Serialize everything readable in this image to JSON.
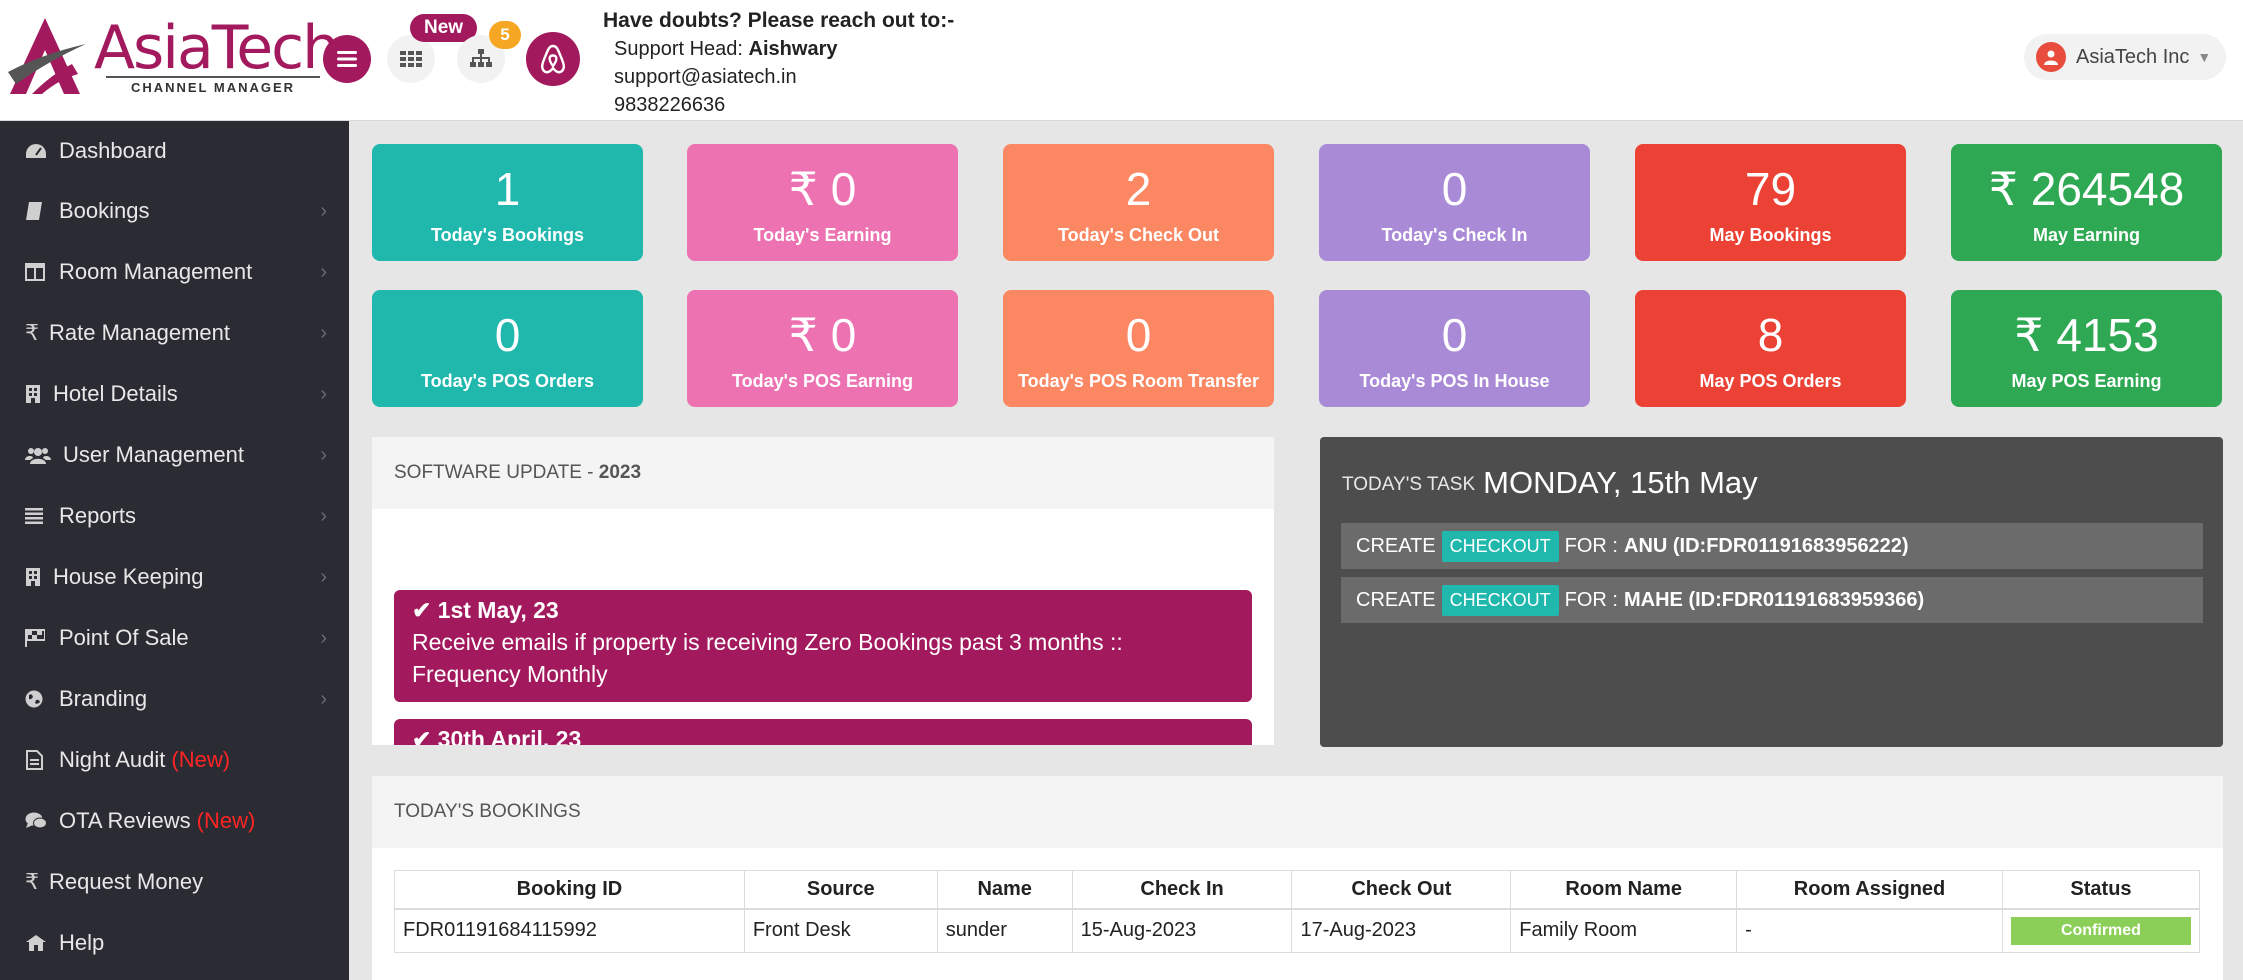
{
  "brand": {
    "name": "AsiaTech",
    "tagline": "CHANNEL MANAGER"
  },
  "header": {
    "new_badge": "New",
    "notification_count": "5",
    "support": {
      "title": "Have doubts? Please reach out to:-",
      "head_label": "Support Head:",
      "head_name": "Aishwary",
      "email": "support@asiatech.in",
      "phone": "9838226636"
    },
    "user": {
      "name": "AsiaTech Inc"
    }
  },
  "sidebar": {
    "items": [
      {
        "label": "Dashboard",
        "icon": "dashboard-icon"
      },
      {
        "label": "Bookings",
        "icon": "book-icon"
      },
      {
        "label": "Room Management",
        "icon": "columns-icon"
      },
      {
        "label": "Rate Management",
        "icon": "rupee-icon"
      },
      {
        "label": "Hotel Details",
        "icon": "building-icon"
      },
      {
        "label": "User Management",
        "icon": "users-icon"
      },
      {
        "label": "Reports",
        "icon": "list-icon"
      },
      {
        "label": "House Keeping",
        "icon": "building-icon"
      },
      {
        "label": "Point Of Sale",
        "icon": "flag-icon"
      },
      {
        "label": "Branding",
        "icon": "globe-icon"
      },
      {
        "label": "Night Audit",
        "icon": "document-icon",
        "tag": "(New)"
      },
      {
        "label": "OTA Reviews",
        "icon": "comments-icon",
        "tag": "(New)"
      },
      {
        "label": "Request Money",
        "icon": "rupee-icon"
      },
      {
        "label": "Help",
        "icon": "help-icon"
      }
    ]
  },
  "stats": [
    {
      "value": "1",
      "label": "Today's Bookings",
      "color": "#20b7ad"
    },
    {
      "value": "₹ 0",
      "label": "Today's Earning",
      "color": "#ec72b1"
    },
    {
      "value": "2",
      "label": "Today's Check Out",
      "color": "#fb8863"
    },
    {
      "value": "0",
      "label": "Today's Check In",
      "color": "#a98ad6"
    },
    {
      "value": "79",
      "label": "May Bookings",
      "color": "#ec4236"
    },
    {
      "value": "₹ 264548",
      "label": "May Earning",
      "color": "#2ea853"
    },
    {
      "value": "0",
      "label": "Today's POS Orders",
      "color": "#20b7ad"
    },
    {
      "value": "₹ 0",
      "label": "Today's POS Earning",
      "color": "#ec72b1"
    },
    {
      "value": "0",
      "label": "Today's POS Room Transfer",
      "color": "#fb8863"
    },
    {
      "value": "0",
      "label": "Today's POS In House",
      "color": "#a98ad6"
    },
    {
      "value": "8",
      "label": "May POS Orders",
      "color": "#ec4236"
    },
    {
      "value": "₹ 4153",
      "label": "May POS Earning",
      "color": "#2ea853"
    }
  ],
  "software_update": {
    "title": "SOFTWARE UPDATE - ",
    "year": "2023",
    "updates": [
      {
        "date": "1st May, 23",
        "text": "Receive emails if property is receiving Zero Bookings past 3 months :: Frequency Monthly"
      },
      {
        "date": "30th April, 23",
        "text": ""
      }
    ]
  },
  "task": {
    "label": "TODAY'S TASK",
    "day": "MONDAY, 15th May",
    "rows": [
      {
        "prefix": "CREATE",
        "chip": "CHECKOUT",
        "for": "FOR :",
        "target": "ANU (ID:FDR01191683956222)"
      },
      {
        "prefix": "CREATE",
        "chip": "CHECKOUT",
        "for": "FOR :",
        "target": "MAHE (ID:FDR01191683959366)"
      }
    ]
  },
  "bookings": {
    "title": "TODAY'S BOOKINGS",
    "columns": [
      "Booking ID",
      "Source",
      "Name",
      "Check In",
      "Check Out",
      "Room Name",
      "Room Assigned",
      "Status"
    ],
    "rows": [
      {
        "id": "FDR01191684115992",
        "source": "Front Desk",
        "name": "sunder",
        "check_in": "15-Aug-2023",
        "check_out": "17-Aug-2023",
        "room_name": "Family Room",
        "room_assigned": "-",
        "status": "Confirmed"
      }
    ]
  }
}
